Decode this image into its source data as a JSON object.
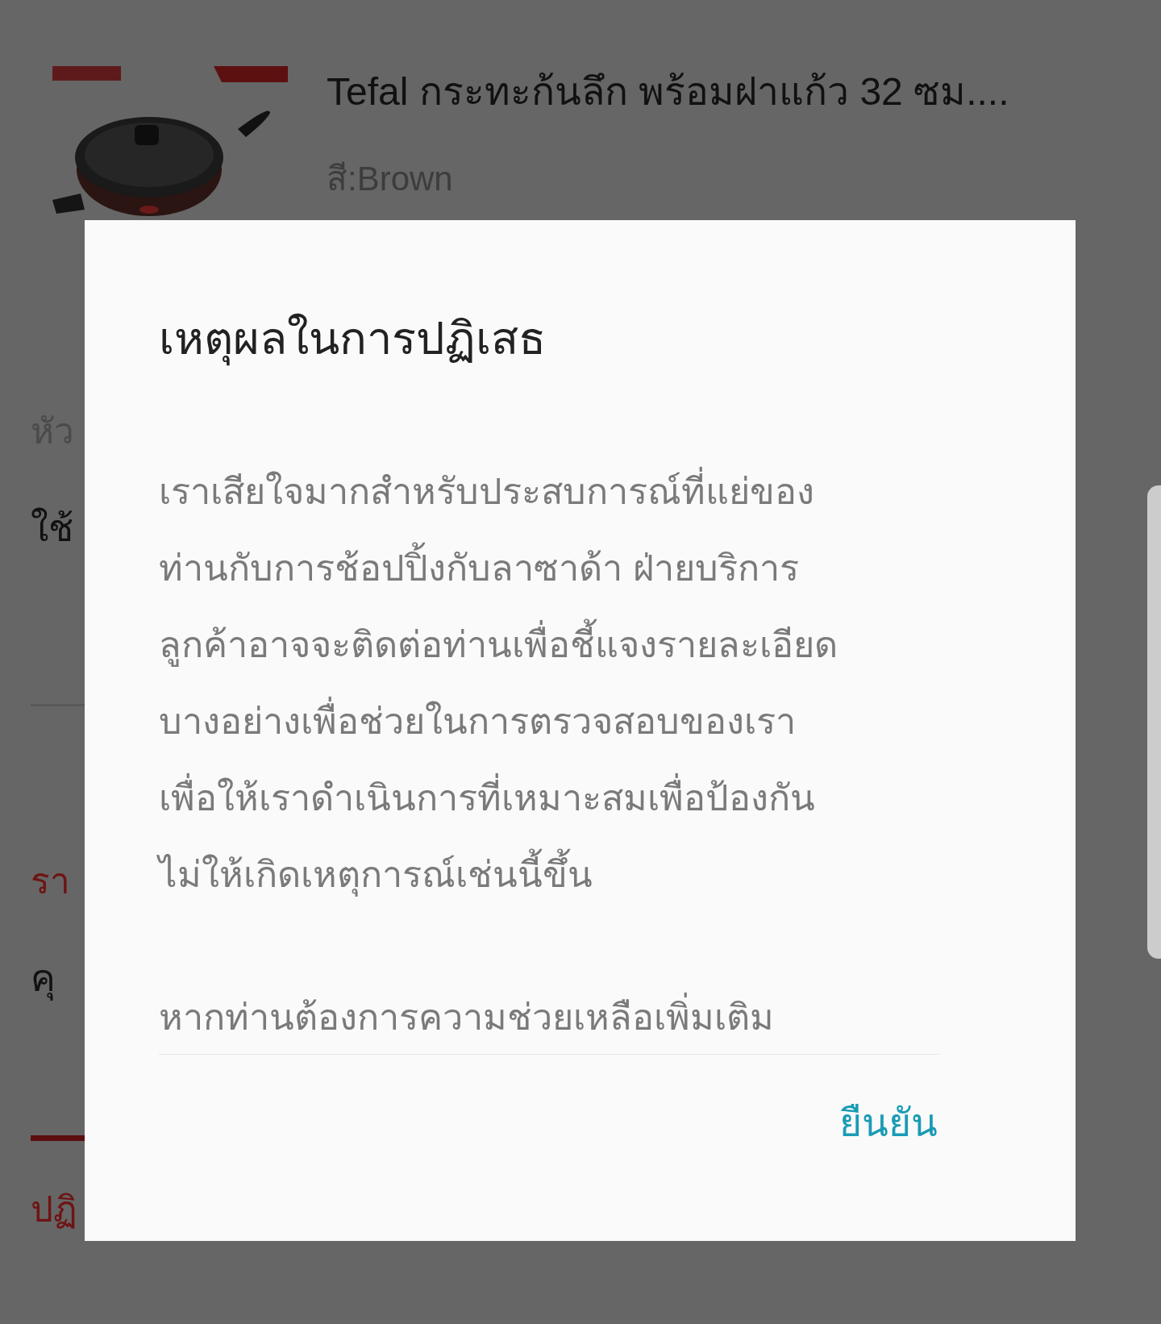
{
  "product": {
    "title": "Tefal กระทะก้นลึก พร้อมฝาแก้ว 32 ซม....",
    "variant": "สี:Brown"
  },
  "background_fragments": [
    {
      "kind": "label",
      "text": "หัว"
    },
    {
      "kind": "value",
      "text": "ใช้"
    },
    {
      "kind": "divider"
    },
    {
      "kind": "heading",
      "text": "รา"
    },
    {
      "kind": "value",
      "text": "คุ"
    },
    {
      "kind": "accent-rule"
    },
    {
      "kind": "heading",
      "text": "ปฏิ"
    }
  ],
  "dialog": {
    "title": "เหตุผลในการปฏิเสธ",
    "message_lines": [
      "เราเสียใจมากสำหรับประสบการณ์ที่แย่ของ",
      "ท่านกับการช้อปปิ้งกับลาซาด้า ฝ่ายบริการ",
      "ลูกค้าอาจจะติดต่อท่านเพื่อชี้แจงรายละเอียด",
      "บางอย่างเพื่อช่วยในการตรวจสอบของเรา",
      "เพื่อให้เราดำเนินการที่เหมาะสมเพื่อป้องกัน",
      "ไม่ให้เกิดเหตุการณ์เช่นนี้ขึ้น"
    ],
    "help_text": "หากท่านต้องการความช่วยเหลือเพิ่มเติม",
    "confirm_button": "ยืนยัน"
  }
}
